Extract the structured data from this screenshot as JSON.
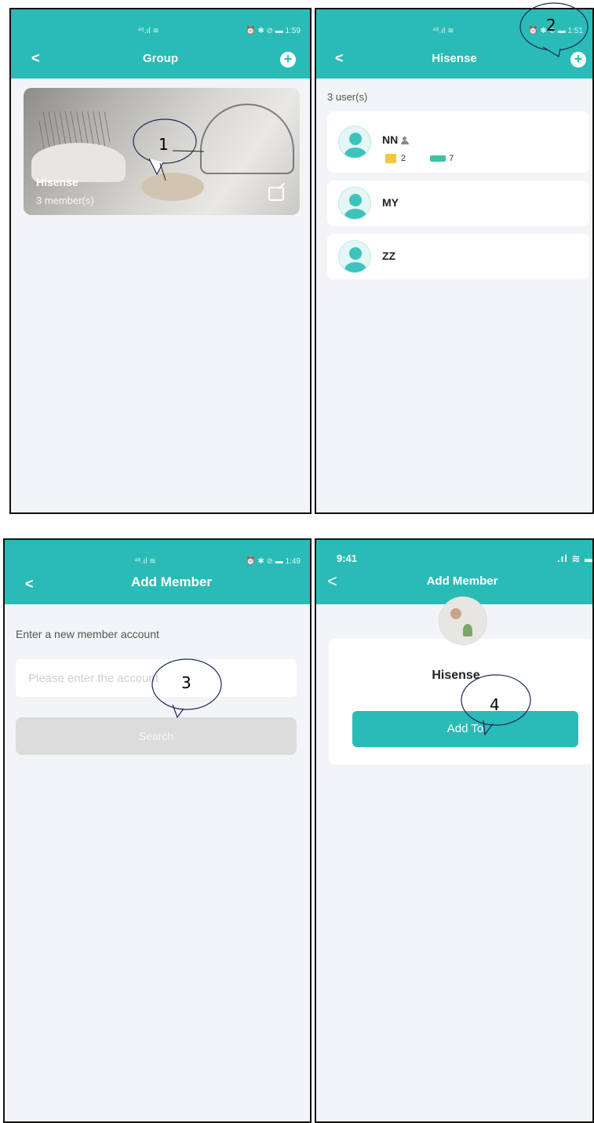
{
  "screen1": {
    "status_signal": "⁴⁶.ıl ≋",
    "status_right": "⏰ ✱ ⊘ ▬ 1:59",
    "title": "Group",
    "group_card": {
      "name": "Hisense",
      "members": "3 member(s)"
    }
  },
  "screen2": {
    "status_signal": "⁴⁶.ıl ≋",
    "status_right": "⏰ ✱ ⊘ ▬ 1:51",
    "title": "Hisense",
    "user_count": "3 user(s)",
    "users": [
      {
        "name": "NN",
        "doors": "2",
        "cards": "7"
      },
      {
        "name": "MY"
      },
      {
        "name": "ZZ"
      }
    ]
  },
  "screen3": {
    "status_signal": "⁴⁶.ıl ≋",
    "status_right": "⏰ ✱ ⊘ ▬ 1:49",
    "title": "Add Member",
    "prompt": "Enter a new member account",
    "input_placeholder": "Please enter the account",
    "search_label": "Search"
  },
  "screen4": {
    "time": "9:41",
    "status_icons": ".ıl ≋ ▬",
    "title": "Add Member",
    "member_name": "Hisense",
    "add_label": "Add To"
  },
  "callouts": [
    "1",
    "2",
    "3",
    "4"
  ]
}
